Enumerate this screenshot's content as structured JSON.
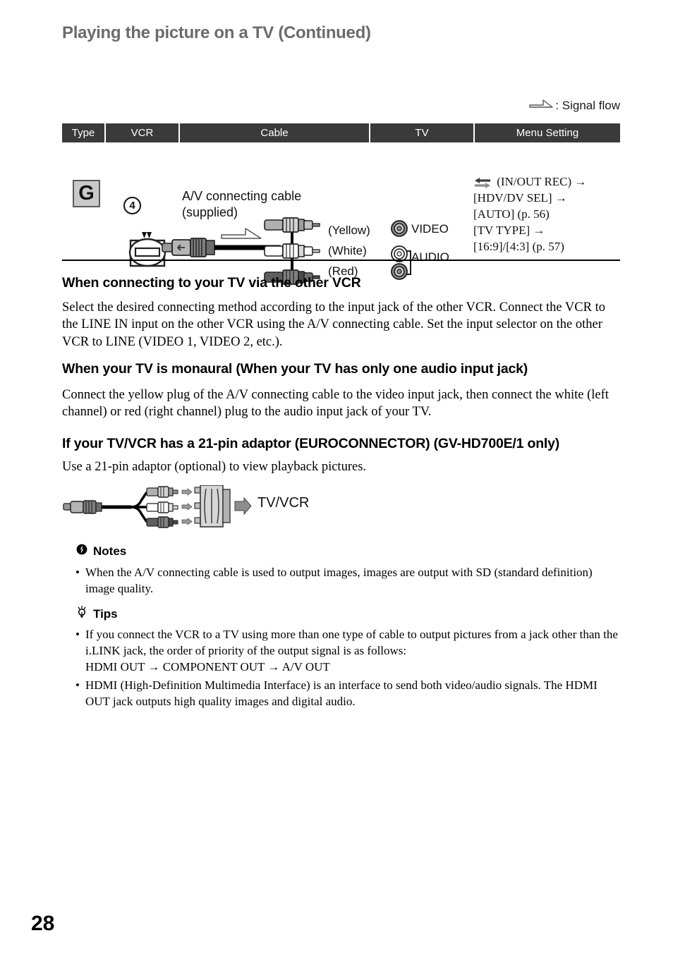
{
  "page": {
    "title": "Playing the picture on a TV (Continued)",
    "number": "28"
  },
  "legend": {
    "icon": "signal-flow-arrow-icon",
    "text": ": Signal flow"
  },
  "table": {
    "headers": {
      "type": "Type",
      "vcr": "VCR",
      "cable": "Cable",
      "tv": "TV",
      "menu": "Menu Setting"
    },
    "row": {
      "type_badge": "G",
      "step_number": "4",
      "cable_name_line1": "A/V connecting cable",
      "cable_name_line2": "(supplied)",
      "plug_labels": {
        "yellow": "(Yellow)",
        "white": "(White)",
        "red": "(Red)"
      },
      "tv_jacks": {
        "video": "VIDEO",
        "audio": "AUDIO"
      },
      "menu_setting": {
        "icon": "in-out-rec-icon",
        "line1": "(IN/OUT REC) →",
        "line2": "[HDV/DV SEL] →",
        "line3": "[AUTO] (p. 56)",
        "line4": "[TV TYPE] →",
        "line5": "[16:9]/[4:3] (p. 57)"
      }
    }
  },
  "sections": [
    {
      "heading": "When connecting to your TV via the other VCR",
      "body": "Select the desired connecting method according to the input jack of the other VCR. Connect the VCR to the LINE IN input on the other VCR using the A/V connecting cable. Set the input selector on the other VCR to LINE (VIDEO 1, VIDEO 2, etc.)."
    },
    {
      "heading": "When your TV is monaural (When your TV has only one audio input jack)",
      "body": "Connect the yellow plug of the A/V connecting cable to the video input jack, then connect the white (left channel) or red (right channel) plug to the audio input jack of your TV."
    },
    {
      "heading": "If your TV/VCR has a 21-pin adaptor (EUROCONNECTOR) (GV-HD700E/1 only)",
      "body": "Use a 21-pin adaptor (optional) to view playback pictures."
    }
  ],
  "euro_diagram": {
    "label": "TV/VCR"
  },
  "notes": {
    "icon": "notes-icon",
    "heading": "Notes",
    "items": [
      "When the A/V connecting cable is used to output images, images are output with SD (standard definition) image quality."
    ]
  },
  "tips": {
    "icon": "lightbulb-icon",
    "heading": "Tips",
    "items": [
      {
        "text": "If you connect the VCR to a TV using more than one type of cable to output pictures from a jack other than the i.LINK jack, the order of priority of the output signal is as follows:",
        "extra": "HDMI OUT → COMPONENT OUT → A/V OUT"
      },
      {
        "text": "HDMI (High-Definition Multimedia Interface) is an interface to send both video/audio signals. The HDMI OUT jack outputs high quality images and digital audio.",
        "extra": ""
      }
    ]
  },
  "colors": {
    "title_gray": "#6b6b6b",
    "table_header_bg": "#3a3a3a",
    "badge_bg": "#c9c9c9"
  }
}
